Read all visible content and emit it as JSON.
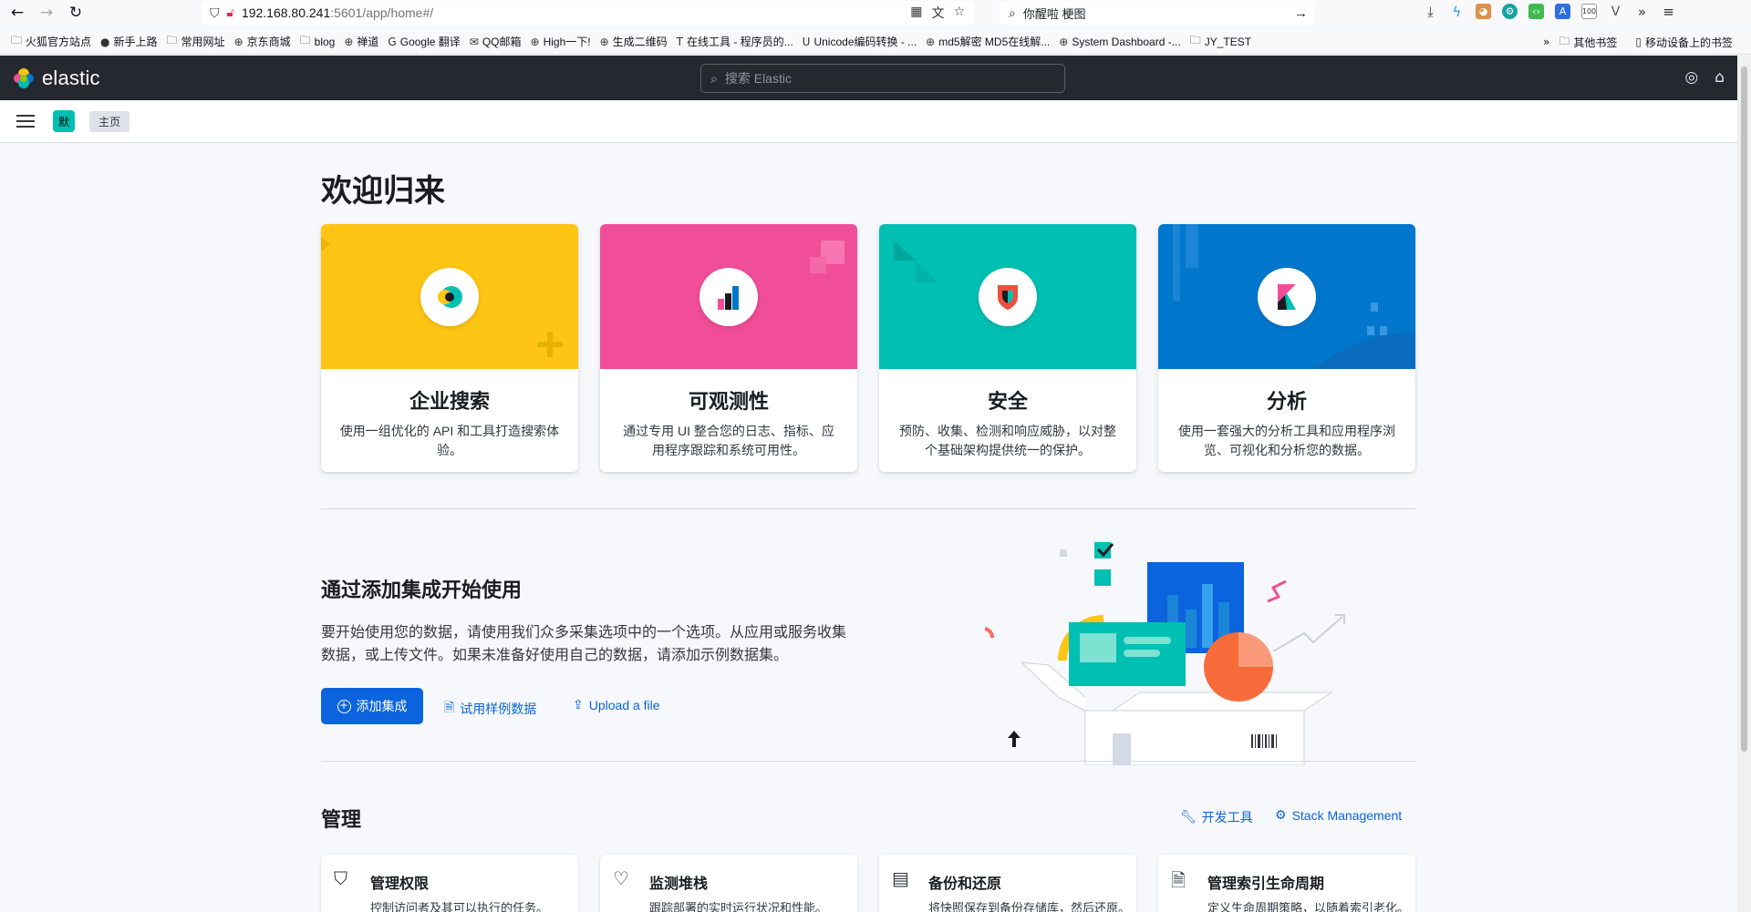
{
  "browser": {
    "url_host": "192.168.80.241",
    "url_rest": ":5601/app/home#/",
    "search_text": "你醒啦 梗图",
    "bookmarks": [
      {
        "label": "火狐官方站点",
        "icon": "folder-icon"
      },
      {
        "label": "新手上路",
        "icon": "firefox-icon"
      },
      {
        "label": "常用网址",
        "icon": "folder-icon"
      },
      {
        "label": "京东商城",
        "icon": "globe-icon"
      },
      {
        "label": "blog",
        "icon": "folder-icon"
      },
      {
        "label": "禅道",
        "icon": "globe-icon"
      },
      {
        "label": "Google 翻译",
        "icon": "translate-icon"
      },
      {
        "label": "QQ邮箱",
        "icon": "mail-icon"
      },
      {
        "label": "High一下!",
        "icon": "globe-icon"
      },
      {
        "label": "生成二维码",
        "icon": "globe-icon"
      },
      {
        "label": "在线工具 - 程序员的...",
        "icon": "tool-icon"
      },
      {
        "label": "Unicode编码转换 - ...",
        "icon": "unicode-icon"
      },
      {
        "label": "md5解密 MD5在线解...",
        "icon": "globe-icon"
      },
      {
        "label": "System Dashboard -...",
        "icon": "globe-icon"
      },
      {
        "label": "JY_TEST",
        "icon": "folder-icon"
      }
    ],
    "bookmarks_other": "其他书签",
    "bookmarks_mobile": "移动设备上的书签"
  },
  "header": {
    "logo_text": "elastic",
    "search_placeholder": "搜索 Elastic",
    "space_initial": "默",
    "breadcrumb": "主页"
  },
  "welcome": {
    "title": "欢迎归来"
  },
  "solutions": [
    {
      "title": "企业搜索",
      "desc": "使用一组优化的 API 和工具打造搜索体验。",
      "color": "#fec514",
      "icon": "enterprise-search-icon"
    },
    {
      "title": "可观测性",
      "desc": "通过专用 UI 整合您的日志、指标、应用程序跟踪和系统可用性。",
      "color": "#f04e98",
      "icon": "observability-icon"
    },
    {
      "title": "安全",
      "desc": "预防、收集、检测和响应威胁，以对整个基础架构提供统一的保护。",
      "color": "#00bfb3",
      "icon": "security-icon"
    },
    {
      "title": "分析",
      "desc": "使用一套强大的分析工具和应用程序浏览、可视化和分析您的数据。",
      "color": "#0077cc",
      "icon": "kibana-icon"
    }
  ],
  "integrations": {
    "title": "通过添加集成开始使用",
    "desc": "要开始使用您的数据，请使用我们众多采集选项中的一个选项。从应用或服务收集数据，或上传文件。如果未准备好使用自己的数据，请添加示例数据集。",
    "add_button": "添加集成",
    "sample_data_link": "试用样例数据",
    "upload_link": "Upload a file"
  },
  "management": {
    "title": "管理",
    "dev_tools_link": "开发工具",
    "stack_management_link": "Stack Management",
    "cards": [
      {
        "title": "管理权限",
        "desc": "控制访问者及其可以执行的任务。",
        "icon": "shield-icon"
      },
      {
        "title": "监测堆栈",
        "desc": "跟踪部署的实时运行状况和性能。",
        "icon": "heartbeat-icon"
      },
      {
        "title": "备份和还原",
        "desc": "将快照保存到备份存储库，然后还原。",
        "icon": "storage-icon"
      },
      {
        "title": "管理索引生命周期",
        "desc": "定义生命周期策略，以随着索引老化。",
        "icon": "document-icon"
      }
    ]
  }
}
